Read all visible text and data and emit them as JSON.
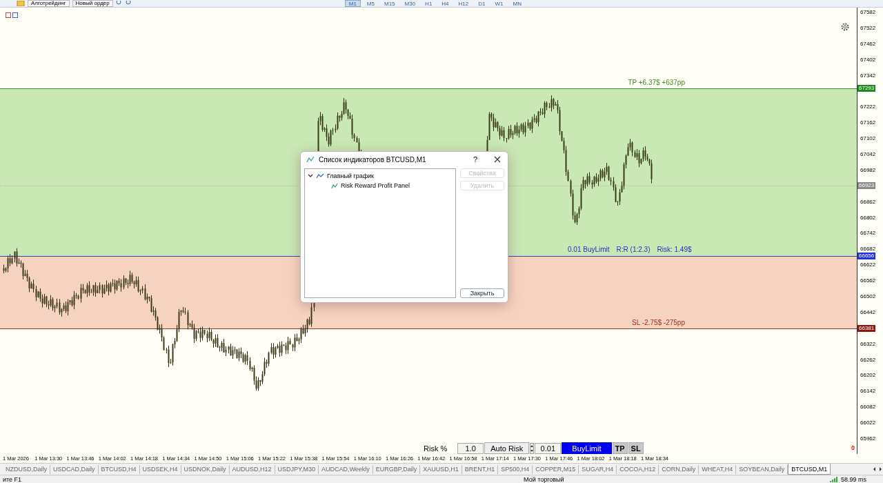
{
  "toolbar": {
    "buttons": [
      "Алготрейдинг",
      "Новый ордер"
    ],
    "timeframes": [
      {
        "label": "M1",
        "selected": true
      },
      {
        "label": "M5",
        "selected": false
      },
      {
        "label": "M15",
        "selected": false
      },
      {
        "label": "M30",
        "selected": false
      },
      {
        "label": "H1",
        "selected": false
      },
      {
        "label": "H4",
        "selected": false
      },
      {
        "label": "H12",
        "selected": false
      },
      {
        "label": "D1",
        "selected": false
      },
      {
        "label": "W1",
        "selected": false
      },
      {
        "label": "MN",
        "selected": false
      }
    ]
  },
  "chart": {
    "price_ticks": [
      "67582",
      "67522",
      "67462",
      "67402",
      "67342",
      "67222",
      "67162",
      "67102",
      "67042",
      "66982",
      "66862",
      "66802",
      "66742",
      "66682",
      "66622",
      "66562",
      "66502",
      "66442",
      "66322",
      "66262",
      "66202",
      "66142",
      "66082",
      "66022",
      "65962"
    ],
    "price_tags": [
      {
        "kind": "tp",
        "value": "67293"
      },
      {
        "kind": "current",
        "value": "66923"
      },
      {
        "kind": "entry",
        "value": "66656"
      },
      {
        "kind": "sl",
        "value": "66381"
      }
    ],
    "tp_label": "TP +6.37$ +637pp",
    "order_label": [
      "0.01 BuyLimit",
      "R:R (1:2.3)",
      "Risk: 1.49$"
    ],
    "sl_label": "SL -2.75$ -275pp",
    "corner_count": "0",
    "time_ticks": [
      "1 Mar 2026",
      "1 Mar 13:30",
      "1 Mar 13:46",
      "1 Mar 14:02",
      "1 Mar 14:18",
      "1 Mar 14:34",
      "1 Mar 14:50",
      "1 Mar 15:06",
      "1 Mar 15:22",
      "1 Mar 15:38",
      "1 Mar 15:54",
      "1 Mar 16:10",
      "1 Mar 16:26",
      "1 Mar 16:42",
      "1 Mar 16:58",
      "1 Mar 17:14",
      "1 Mar 17:30",
      "1 Mar 17:46",
      "1 Mar 18:02",
      "1 Mar 18:18",
      "1 Mar 18:34"
    ]
  },
  "trade_panel": {
    "risk_label": "Risk %",
    "risk_value": "1.0",
    "auto_risk_button": "Auto Risk",
    "lot_value": "0.01",
    "order_button": "BuyLimit",
    "tp_button": "TP",
    "sl_button": "SL"
  },
  "dialog": {
    "title": "Список индикаторов BTCUSD,M1",
    "help": "?",
    "tree": [
      {
        "label": "Главный график",
        "expanded": true,
        "children": [
          {
            "label": "Risk Reward Profit Panel"
          }
        ]
      }
    ],
    "buttons": [
      {
        "label": "Свойства",
        "disabled": true
      },
      {
        "label": "Удалить",
        "disabled": true
      },
      {
        "label": "Закрыть",
        "disabled": false
      }
    ]
  },
  "symbol_tabs": [
    {
      "label": "NZDUSD,Daily",
      "selected": false
    },
    {
      "label": "USDCAD,Daily",
      "selected": false
    },
    {
      "label": "BTCUSD,H4",
      "selected": false
    },
    {
      "label": "USDSEK,H4",
      "selected": false
    },
    {
      "label": "USDNOK,Daily",
      "selected": false
    },
    {
      "label": "AUDUSD,H12",
      "selected": false
    },
    {
      "label": "USDJPY,M30",
      "selected": false
    },
    {
      "label": "AUDCAD,Weekly",
      "selected": false
    },
    {
      "label": "EURGBP,Daily",
      "selected": false
    },
    {
      "label": "XAUUSD,H1",
      "selected": false
    },
    {
      "label": "BRENT,H1",
      "selected": false
    },
    {
      "label": "SP500,H4",
      "selected": false
    },
    {
      "label": "COPPER,M15",
      "selected": false
    },
    {
      "label": "SUGAR,H4",
      "selected": false
    },
    {
      "label": "COCOA,H12",
      "selected": false
    },
    {
      "label": "CORN,Daily",
      "selected": false
    },
    {
      "label": "WHEAT,H4",
      "selected": false
    },
    {
      "label": "SOYBEAN,Daily",
      "selected": false
    },
    {
      "label": "BTCUSD,M1",
      "selected": true
    }
  ],
  "status_bar": {
    "help_hint": "ите F1",
    "account": "Мой торговый",
    "ping": "58.99 ms"
  }
}
